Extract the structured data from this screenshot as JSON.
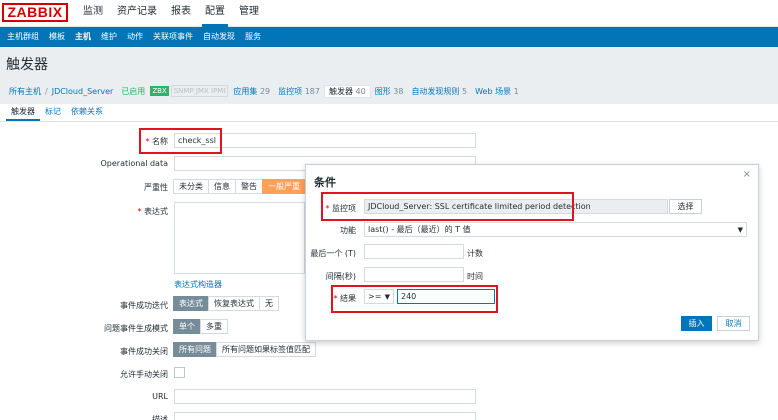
{
  "logo": "ZABBIX",
  "top_menu": [
    "监测",
    "资产记录",
    "报表",
    "配置",
    "管理"
  ],
  "top_menu_active": 3,
  "sub_menu": [
    "主机群组",
    "模板",
    "主机",
    "维护",
    "动作",
    "关联项事件",
    "自动发现",
    "服务"
  ],
  "sub_menu_active": 2,
  "page_title": "触发器",
  "breadcrumb": {
    "all_hosts": "所有主机",
    "sep": "/",
    "host": "JDCloud_Server",
    "status": "已启用",
    "zbx": "ZBX",
    "other_ifaces": "SNMP JMX IPMI",
    "apps": "应用集",
    "apps_count": "29",
    "items": "监控项",
    "items_count": "187",
    "triggers": "触发器",
    "triggers_count": "40",
    "graphs": "图形",
    "graphs_count": "38",
    "discovery": "自动发现规则",
    "discovery_count": "5",
    "web": "Web 场景",
    "web_count": "1"
  },
  "tabs": [
    "触发器",
    "标记",
    "依赖关系"
  ],
  "form": {
    "name_label": "名称",
    "name_value": "check_ssl",
    "opdata_label": "Operational data",
    "severity_label": "严重性",
    "severity_options": [
      "未分类",
      "信息",
      "警告",
      "一般严重"
    ],
    "expression_label": "表达式",
    "expression_builder": "表达式构造器",
    "ok_event_label": "事件成功迭代",
    "ok_event_options": [
      "表达式",
      "恢复表达式",
      "无"
    ],
    "problem_mode_label": "问题事件生成模式",
    "problem_mode_options": [
      "单个",
      "多重"
    ],
    "ok_close_label": "事件成功关闭",
    "ok_close_options": [
      "所有问题",
      "所有问题如果标签值匹配"
    ],
    "manual_close_label": "允许手动关闭",
    "url_label": "URL",
    "desc_label": "描述"
  },
  "modal": {
    "title": "条件",
    "close": "×",
    "item_label": "监控项",
    "item_value": "JDCloud_Server: SSL certificate limited period detection",
    "select_button": "选择",
    "function_label": "功能",
    "function_value": "last() - 最后（最近）的 T 值",
    "last_label": "最后一个 (T)",
    "last_unit": "计数",
    "interval_label": "间隔(秒)",
    "interval_unit": "时间",
    "result_label": "结果",
    "result_operator": ">=",
    "result_value": "240",
    "insert_button": "插入",
    "cancel_button": "取消"
  },
  "colors": {
    "brand": "#d40000",
    "accent": "#0275b8",
    "highlight_box": "#e0141e",
    "severity_average": "#ffa059"
  }
}
